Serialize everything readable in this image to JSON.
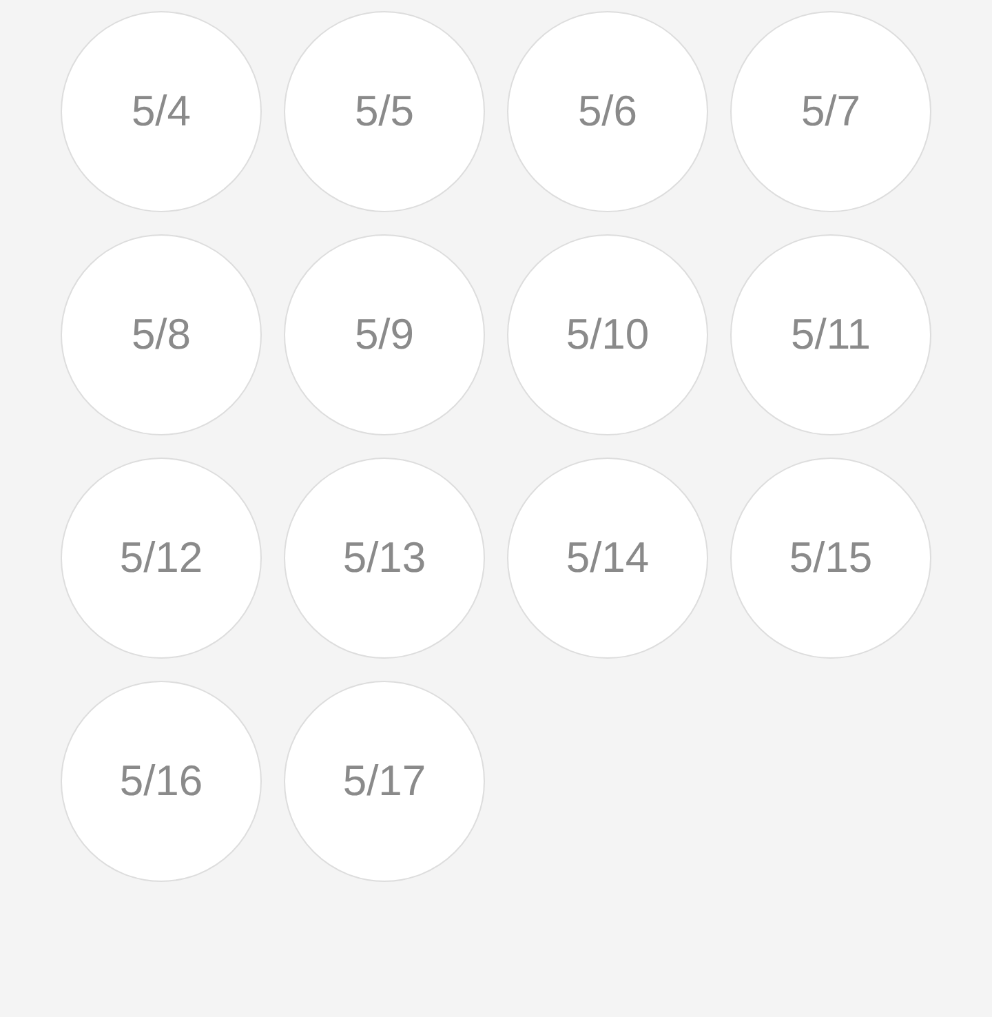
{
  "dates": [
    "5/4",
    "5/5",
    "5/6",
    "5/7",
    "5/8",
    "5/9",
    "5/10",
    "5/11",
    "5/12",
    "5/13",
    "5/14",
    "5/15",
    "5/16",
    "5/17"
  ]
}
